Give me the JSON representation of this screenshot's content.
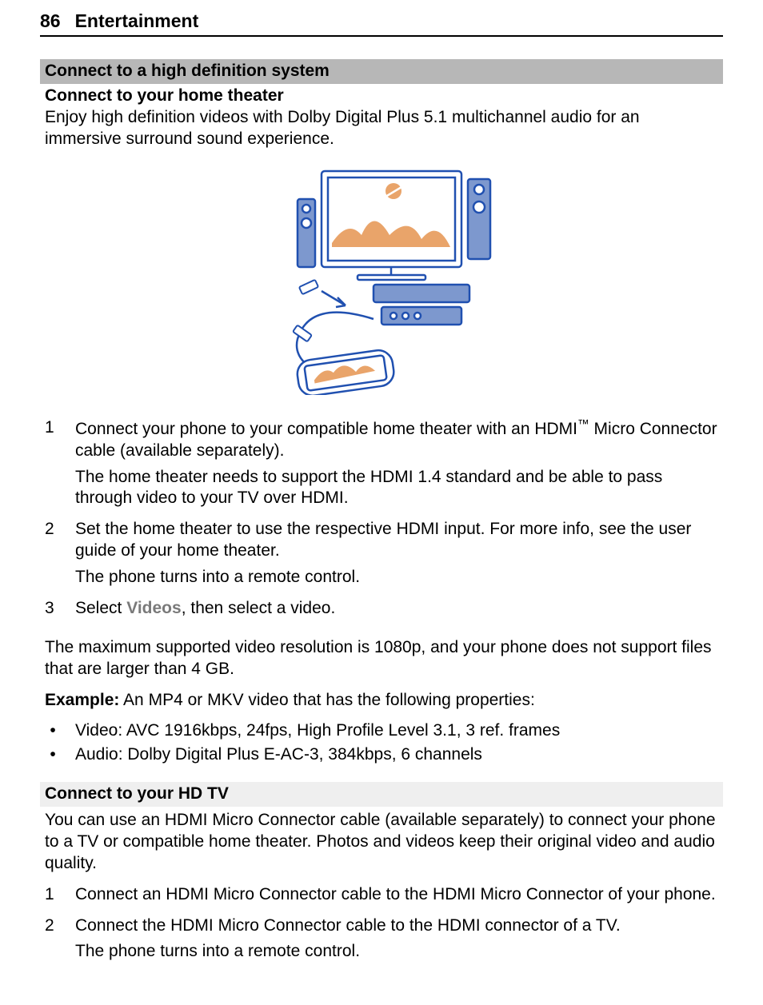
{
  "header": {
    "page_number": "86",
    "chapter": "Entertainment"
  },
  "section1": {
    "heading_strong": "Connect to a high definition system",
    "sub_heading": "Connect to your home theater",
    "intro": "Enjoy high definition videos with Dolby Digital Plus 5.1 multichannel audio for an immersive surround sound experience.",
    "steps": [
      {
        "n": "1",
        "para1_before_tm": "Connect your phone to your compatible home theater with an HDMI",
        "tm": "™",
        "para1_after_tm": " Micro Connector cable (available separately).",
        "para2": "The home theater needs to support the HDMI 1.4 standard and be able to pass through video to your TV over HDMI."
      },
      {
        "n": "2",
        "para1": "Set the home theater to use the respective HDMI input. For more info, see the user guide of your home theater.",
        "para2": "The phone turns into a remote control."
      },
      {
        "n": "3",
        "pre": "Select ",
        "menu": "Videos",
        "post": ", then select a video."
      }
    ],
    "max_res": "The maximum supported video resolution is 1080p, and your phone does not support files that are larger than 4 GB.",
    "example_label": "Example:",
    "example_text": " An MP4 or MKV video that has the following properties:",
    "bullets": [
      "Video: AVC 1916kbps, 24fps, High Profile Level 3.1, 3 ref. frames",
      "Audio: Dolby Digital Plus E-AC-3, 384kbps, 6 channels"
    ]
  },
  "section2": {
    "heading": "Connect to your HD TV",
    "intro": "You can use an HDMI Micro Connector cable (available separately) to connect your phone to a TV or compatible home theater. Photos and videos keep their original video and audio quality.",
    "steps": [
      {
        "n": "1",
        "para1": "Connect an HDMI Micro Connector cable to the HDMI Micro Connector of your phone."
      },
      {
        "n": "2",
        "para1": "Connect the HDMI Micro Connector cable to the HDMI connector of a TV.",
        "para2": "The phone turns into a remote control."
      }
    ]
  }
}
